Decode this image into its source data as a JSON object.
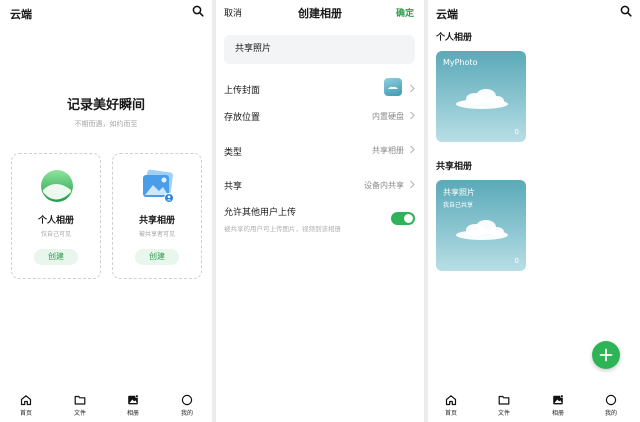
{
  "screen1": {
    "title": "云端",
    "hero_title": "记录美好瞬间",
    "hero_subtitle": "不期而遇，如约而至",
    "cards": [
      {
        "name": "个人相册",
        "desc": "仅自己可见",
        "button": "创建"
      },
      {
        "name": "共享相册",
        "desc": "被共享者可见",
        "button": "创建"
      }
    ]
  },
  "screen2": {
    "cancel": "取消",
    "title": "创建相册",
    "confirm": "确定",
    "name_value": "共享照片",
    "rows": [
      {
        "label": "上传封面",
        "value": ""
      },
      {
        "label": "存放位置",
        "value": "内置硬盘"
      },
      {
        "label": "类型",
        "value": "共享相册"
      },
      {
        "label": "共享",
        "value": "设备内共享"
      }
    ],
    "allow_upload_label": "允许其他用户上传",
    "allow_upload_hint": "被共享的用户可上传图片，视频到该相册",
    "allow_upload_on": true
  },
  "screen3": {
    "title": "云端",
    "personal_section": "个人相册",
    "personal_album": {
      "title": "MyPhoto",
      "count": "0"
    },
    "shared_section": "共享相册",
    "shared_album": {
      "title": "共享照片",
      "subtitle": "我自己共享",
      "count": "0"
    }
  },
  "nav": {
    "home": "首页",
    "files": "文件",
    "albums": "相册",
    "mine": "我的"
  },
  "colors": {
    "accent": "#2e9b4f",
    "toggle_on": "#2fb35a",
    "fab": "#2cb457"
  }
}
